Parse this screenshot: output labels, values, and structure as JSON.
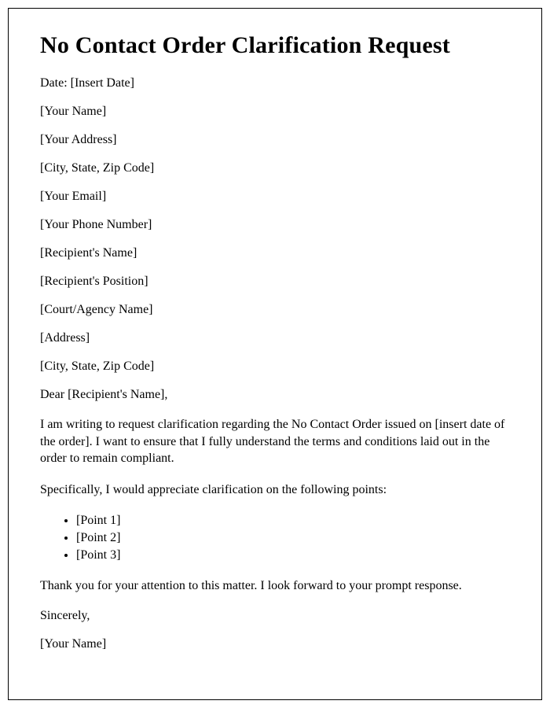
{
  "title": "No Contact Order Clarification Request",
  "sender": {
    "date_label": "Date: [Insert Date]",
    "name": "[Your Name]",
    "address": "[Your Address]",
    "city_state_zip": "[City, State, Zip Code]",
    "email": "[Your Email]",
    "phone": "[Your Phone Number]"
  },
  "recipient": {
    "name": "[Recipient's Name]",
    "position": "[Recipient's Position]",
    "court_agency": "[Court/Agency Name]",
    "address": "[Address]",
    "city_state_zip": "[City, State, Zip Code]"
  },
  "salutation": "Dear [Recipient's Name],",
  "paragraph_1": "I am writing to request clarification regarding the No Contact Order issued on [insert date of the order]. I want to ensure that I fully understand the terms and conditions laid out in the order to remain compliant.",
  "paragraph_2": "Specifically, I would appreciate clarification on the following points:",
  "points": [
    "[Point 1]",
    "[Point 2]",
    "[Point 3]"
  ],
  "paragraph_3": "Thank you for your attention to this matter. I look forward to your prompt response.",
  "closing": "Sincerely,",
  "signature": "[Your Name]"
}
